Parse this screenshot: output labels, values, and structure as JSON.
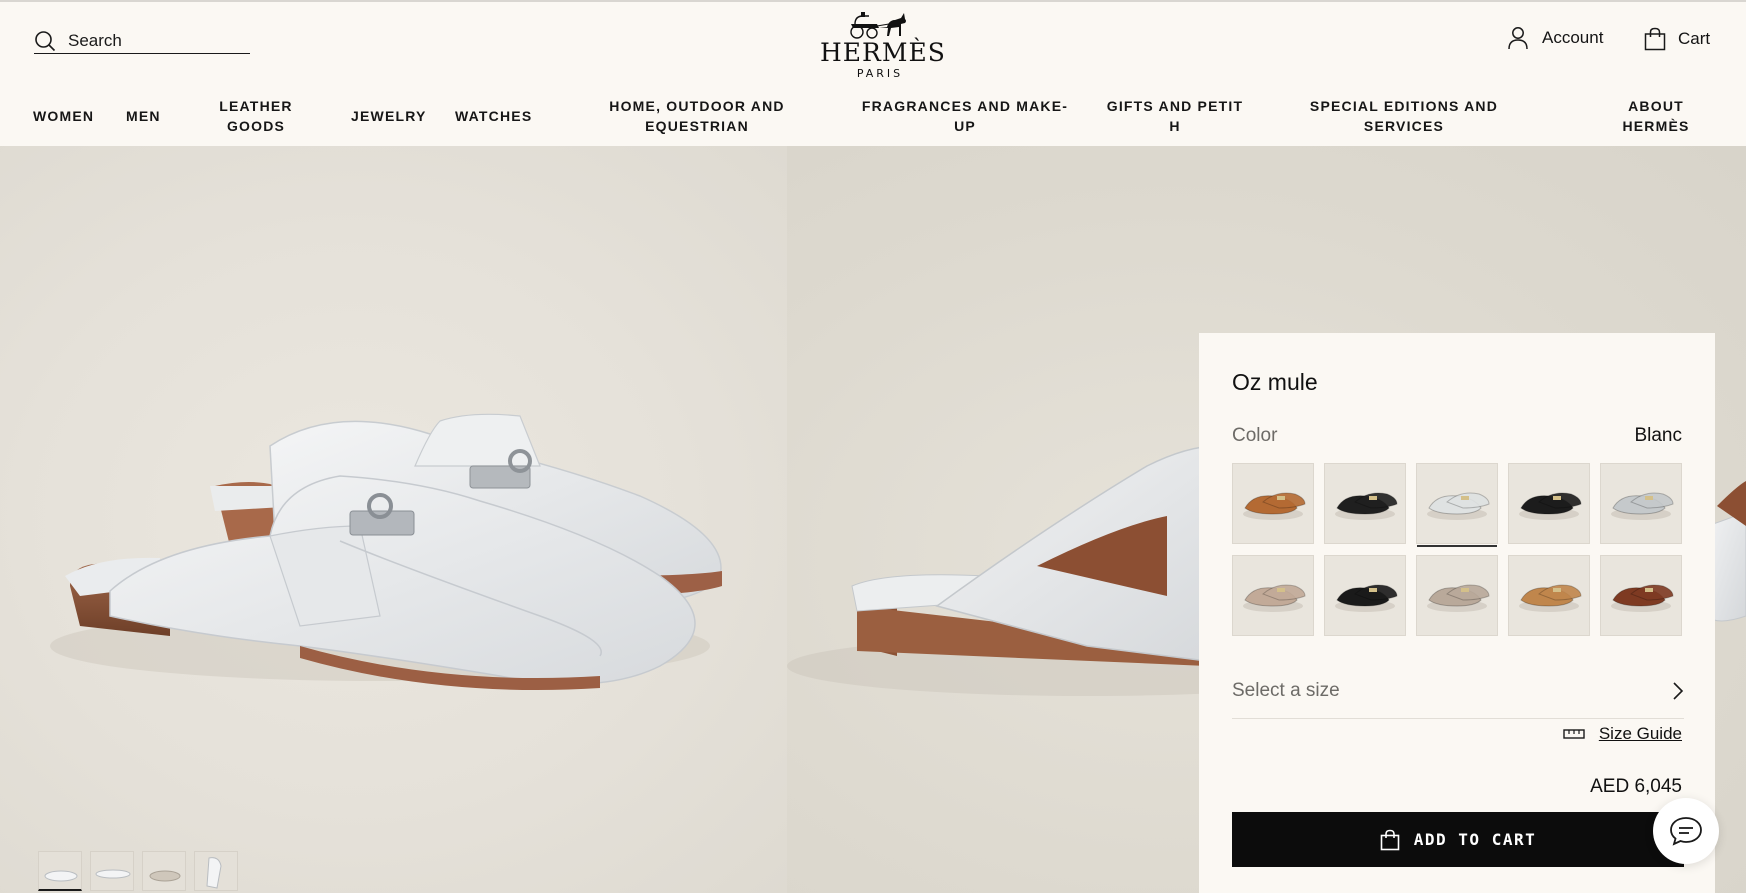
{
  "header": {
    "search_label": "Search",
    "logo_text": "HERMÈS",
    "logo_sub": "PARIS",
    "account_label": "Account",
    "cart_label": "Cart"
  },
  "nav": {
    "items": [
      {
        "label": "Women"
      },
      {
        "label": "Men"
      },
      {
        "label": "Leather goods"
      },
      {
        "label": "Jewelry"
      },
      {
        "label": "Watches"
      },
      {
        "label": "Home, outdoor and equestrian"
      },
      {
        "label": "Fragrances and make-up"
      },
      {
        "label": "Gifts and petit h"
      },
      {
        "label": "Special editions and services"
      },
      {
        "label": "About Hermès"
      }
    ]
  },
  "product": {
    "name": "Oz mule",
    "color_label": "Color",
    "color_value": "Blanc",
    "swatches": [
      {
        "color": "#b46a33",
        "icon": "tan-mule-swatch"
      },
      {
        "color": "#1f1f1f",
        "icon": "black-mule-swatch"
      },
      {
        "color": "#dfe2e2",
        "icon": "white-mule-swatch",
        "selected": true
      },
      {
        "color": "#1c1c1c",
        "icon": "black-gold-mule-swatch"
      },
      {
        "color": "#c5c9cb",
        "icon": "grey-mule-swatch"
      },
      {
        "color": "#c2aa98",
        "icon": "taupe-mule-swatch"
      },
      {
        "color": "#1a1a1a",
        "icon": "black-open-mule-swatch"
      },
      {
        "color": "#b9a99a",
        "icon": "etoupe-mule-swatch"
      },
      {
        "color": "#c0864c",
        "icon": "fauve-mule-swatch"
      },
      {
        "color": "#7e3a22",
        "icon": "brown-mule-swatch"
      }
    ],
    "size_placeholder": "Select a size",
    "size_guide_label": "Size Guide",
    "price": "AED 6,045",
    "add_to_cart_label": "ADD TO CART"
  },
  "gallery": {
    "thumbnails": [
      "pair-front-view",
      "pair-top-view",
      "pair-side-view",
      "single-detail-view"
    ]
  },
  "colors": {
    "header_bg": "#fbf8f3",
    "button_bg": "#0c0c0c",
    "muted_text": "#6d6b67"
  }
}
